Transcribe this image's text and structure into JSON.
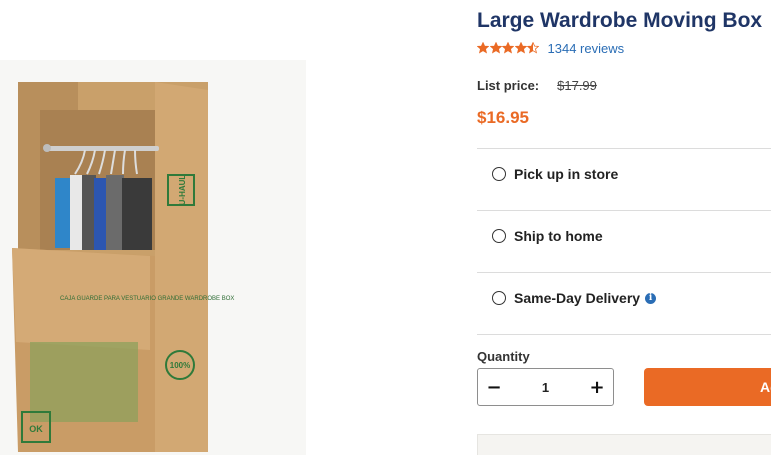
{
  "product": {
    "title": "Large Wardrobe Moving Box",
    "rating": 4.5,
    "reviews_text": "1344 reviews",
    "list_price_label": "List price:",
    "list_price": "$17.99",
    "price": "$16.95",
    "image_alt": "Large wardrobe moving box with hanging clothes",
    "image_text": {
      "logo": "U-HAUL",
      "box_label": "CAJA GUARDE PARA VESTUARIO GRANDE WARDROBE BOX",
      "badge": "100%",
      "checkmark": "OK"
    }
  },
  "fulfillment": {
    "options": [
      {
        "label": "Pick up in store",
        "selected": false,
        "info": false
      },
      {
        "label": "Ship to home",
        "selected": false,
        "info": false
      },
      {
        "label": "Same-Day Delivery",
        "selected": false,
        "info": true
      }
    ]
  },
  "quantity": {
    "label": "Quantity",
    "value": "1",
    "minus": "−",
    "plus": "+"
  },
  "cart": {
    "add_label": "Add to cart"
  },
  "colors": {
    "title": "#1f3566",
    "price": "#ea6a25",
    "star": "#ea6a25",
    "link": "#2a6db5",
    "button": "#ea6a25"
  }
}
